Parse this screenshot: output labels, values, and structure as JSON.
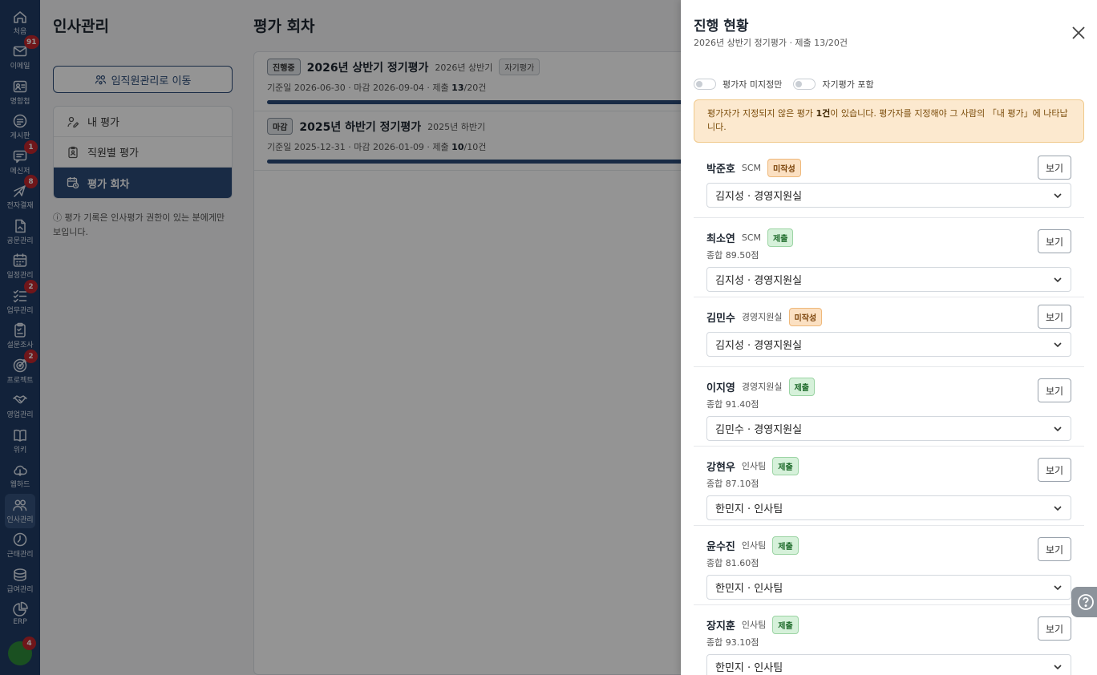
{
  "rail": {
    "items": [
      {
        "label": "처음",
        "icon": "home-icon",
        "badge": ""
      },
      {
        "label": "이메일",
        "icon": "mail-icon",
        "badge": "91"
      },
      {
        "label": "명함첩",
        "icon": "contacts-icon",
        "badge": ""
      },
      {
        "label": "게시판",
        "icon": "board-icon",
        "badge": ""
      },
      {
        "label": "메신저",
        "icon": "messenger-icon",
        "badge": "1"
      },
      {
        "label": "전자결재",
        "icon": "approval-icon",
        "badge": "8"
      },
      {
        "label": "공문관리",
        "icon": "document-icon",
        "badge": ""
      },
      {
        "label": "일정관리",
        "icon": "calendar-icon",
        "badge": ""
      },
      {
        "label": "업무관리",
        "icon": "tasks-icon",
        "badge": "2"
      },
      {
        "label": "설문조사",
        "icon": "survey-icon",
        "badge": ""
      },
      {
        "label": "프로젝트",
        "icon": "project-icon",
        "badge": "2"
      },
      {
        "label": "영업관리",
        "icon": "handshake-icon",
        "badge": ""
      },
      {
        "label": "위키",
        "icon": "book-icon",
        "badge": ""
      },
      {
        "label": "웹하드",
        "icon": "cloud-icon",
        "badge": ""
      },
      {
        "label": "인사관리",
        "icon": "people-icon",
        "badge": ""
      },
      {
        "label": "근태관리",
        "icon": "clock-icon",
        "badge": ""
      },
      {
        "label": "급여관리",
        "icon": "coins-icon",
        "badge": ""
      },
      {
        "label": "ERP",
        "icon": "pie-icon",
        "badge": ""
      }
    ],
    "avatar_badge": "4"
  },
  "left": {
    "title": "인사관리",
    "move_button": "임직원관리로 이동",
    "nav": [
      {
        "label": "내 평가",
        "icon": "pen-user-icon"
      },
      {
        "label": "직원별 평가",
        "icon": "clipboard-user-icon"
      },
      {
        "label": "평가 회차",
        "icon": "calendar-clock-icon"
      }
    ],
    "note": "평가 기록은 인사평가 권한이 있는 분에게만 보입니다."
  },
  "rounds": {
    "title": "평가 회차",
    "items": [
      {
        "status": "진행중",
        "name": "2026년 상반기 정기평가",
        "term": "2026년 상반기",
        "type": "자기평가",
        "meta_prefix": "기준일 2026-06-30 · 마감 2026-09-04 · 제출 ",
        "submitted": "13",
        "total": "/20건",
        "progress": 0.65
      },
      {
        "status": "마감",
        "name": "2025년 하반기 정기평가",
        "term": "2025년 하반기",
        "type": "",
        "meta_prefix": "기준일 2025-12-31 · 마감 2026-01-09 · 제출 ",
        "submitted": "10",
        "total": "/10건",
        "progress": 1.0
      }
    ]
  },
  "drawer": {
    "title": "진행 현황",
    "subtitle": "2026년 상반기 정기평가 · 제출 13/20건",
    "toggle_unassigned": "평가자 미지정만",
    "toggle_self": "자기평가 포함",
    "alert_prefix": "평가자가 지정되지 않은 평가 ",
    "alert_count": "1건",
    "alert_suffix": "이 있습니다. 평가자를 지정해야 그 사람의 「내 평가」에 나타납니다.",
    "view_label": "보기",
    "rows": [
      {
        "name": "박준호",
        "dept": "SCM",
        "status": "미작성",
        "state": "draft",
        "score": "",
        "evaluator": "김지성 · 경영지원실"
      },
      {
        "name": "최소연",
        "dept": "SCM",
        "status": "제출",
        "state": "done",
        "score": "종합 89.50점",
        "evaluator": "김지성 · 경영지원실"
      },
      {
        "name": "김민수",
        "dept": "경영지원실",
        "status": "미작성",
        "state": "draft",
        "score": "",
        "evaluator": "김지성 · 경영지원실"
      },
      {
        "name": "이지영",
        "dept": "경영지원실",
        "status": "제출",
        "state": "done",
        "score": "종합 91.40점",
        "evaluator": "김민수 · 경영지원실"
      },
      {
        "name": "강현우",
        "dept": "인사팀",
        "status": "제출",
        "state": "done",
        "score": "종합 87.10점",
        "evaluator": "한민지 · 인사팀"
      },
      {
        "name": "윤수진",
        "dept": "인사팀",
        "status": "제출",
        "state": "done",
        "score": "종합 81.60점",
        "evaluator": "한민지 · 인사팀"
      },
      {
        "name": "장지훈",
        "dept": "인사팀",
        "status": "제출",
        "state": "done",
        "score": "종합 93.10점",
        "evaluator": "한민지 · 인사팀"
      }
    ]
  }
}
